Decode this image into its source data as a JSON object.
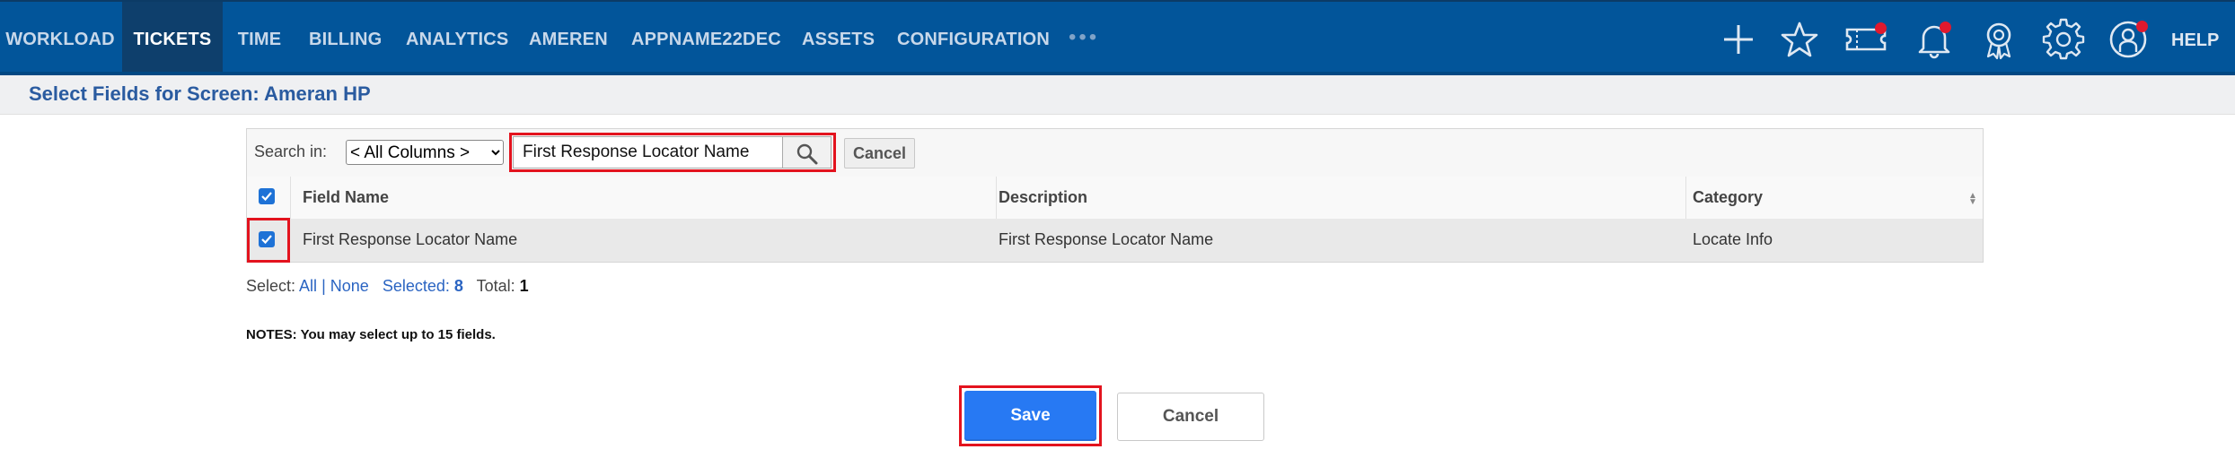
{
  "nav": {
    "items": [
      "WORKLOAD",
      "TICKETS",
      "TIME",
      "BILLING",
      "ANALYTICS",
      "AMEREN",
      "APPNAME22DEC",
      "ASSETS",
      "CONFIGURATION"
    ],
    "active": "TICKETS",
    "more": "•••",
    "help": "HELP",
    "icons": [
      "plus-icon",
      "star-icon",
      "ticket-icon",
      "bell-icon",
      "badge-icon",
      "gear-icon",
      "user-icon"
    ]
  },
  "header": {
    "title": "Select Fields for Screen: Ameran HP"
  },
  "search": {
    "label": "Search in:",
    "scope": "< All Columns >",
    "value": "First Response Locator Name",
    "cancel": "Cancel"
  },
  "table": {
    "headers": [
      "Field Name",
      "Description",
      "Category"
    ],
    "rows": [
      {
        "checked": true,
        "field_name": "First Response Locator Name",
        "description": "First Response Locator Name",
        "category": "Locate Info"
      }
    ]
  },
  "selection": {
    "select_label": "Select:",
    "all": "All",
    "separator": "|",
    "none": "None",
    "selected_label": "Selected:",
    "selected_count": "8",
    "total_label": "Total:",
    "total_count": "1"
  },
  "notes": "NOTES: You may select up to 15 fields.",
  "buttons": {
    "save": "Save",
    "cancel": "Cancel"
  },
  "colors": {
    "nav_bg": "#02559a",
    "nav_active": "#0e3f6c",
    "accent": "#2779f3",
    "highlight": "#e3131e",
    "badge": "#e0192e"
  }
}
